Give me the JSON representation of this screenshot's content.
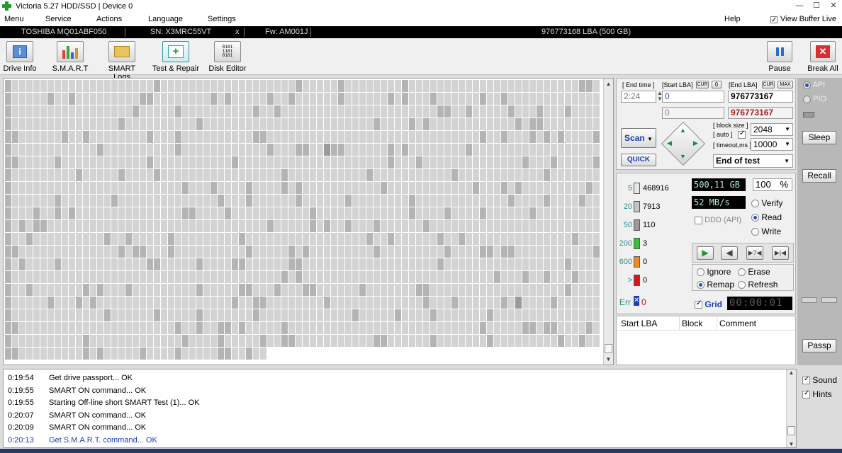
{
  "title": "Victoria 5.27 HDD/SSD | Device 0",
  "window_controls": [
    "—",
    "☐",
    "✕"
  ],
  "menu": {
    "items": [
      "Menu",
      "Service",
      "Actions",
      "Language",
      "Settings"
    ],
    "help": "Help",
    "view_buffer_live": "View Buffer Live"
  },
  "drive_info_bar": {
    "model": "TOSHIBA MQ01ABF050",
    "serial": "SN: X3MRC55VT",
    "close": "x",
    "firmware": "Fw: AM001J",
    "capacity": "976773168 LBA (500 GB)"
  },
  "toolbar": {
    "drive_info": "Drive Info",
    "smart": "S.M.A.R.T",
    "smart_logs": "SMART Logs",
    "test_repair": "Test & Repair",
    "disk_editor": "Disk Editor",
    "pause": "Pause",
    "break_all": "Break All"
  },
  "scan_settings": {
    "end_time_label": "[ End time ]",
    "end_time": "2:24",
    "start_lba_label": "[Start LBA]",
    "cur_label": "CUR",
    "zero_label": "0",
    "end_lba_label": "[End LBA]",
    "max_label": "MAX",
    "start_lba": "0",
    "end_lba": "976773167",
    "start_lba_2": "0",
    "end_lba_2": "976773167",
    "scan_button": "Scan",
    "quick_button": "QUICK",
    "block_size_label": "[ block size ]",
    "auto_label": "[ auto ]",
    "block_size": "2048",
    "timeout_label": "[ timeout,ms ]",
    "timeout": "10000",
    "end_action": "End of test"
  },
  "stats": {
    "rows": [
      {
        "label": "5",
        "value": "468916",
        "color": "#e8e8e8"
      },
      {
        "label": "20",
        "value": "7913",
        "color": "#c4c4c4"
      },
      {
        "label": "50",
        "value": "110",
        "color": "#9a9a9a"
      },
      {
        "label": "200",
        "value": "3",
        "color": "#36c236"
      },
      {
        "label": "600",
        "value": "0",
        "color": "#f08c1e"
      },
      {
        "label": ">",
        "value": "0",
        "color": "#d81818"
      }
    ],
    "err_label": "Err",
    "err_value": "0",
    "size_done": "500,11 GB",
    "percent": "100",
    "percent_sign": "%",
    "speed": "52 MB/s",
    "ddd_label": "DDD (API)",
    "mode_verify": "Verify",
    "mode_read": "Read",
    "mode_write": "Write",
    "action_ignore": "Ignore",
    "action_erase": "Erase",
    "action_remap": "Remap",
    "action_refresh": "Refresh",
    "grid_label": "Grid",
    "elapsed": "00:00:01"
  },
  "defects_table": {
    "columns": [
      "Start LBA",
      "Block",
      "Comment"
    ]
  },
  "side": {
    "api": "API",
    "pio": "PIO",
    "sleep": "Sleep",
    "recall": "Recall",
    "passp": "Passp",
    "sound": "Sound",
    "hints": "Hints"
  },
  "log": [
    {
      "time": "0:19:54",
      "text": "Get drive passport... OK",
      "color": "#000000"
    },
    {
      "time": "0:19:55",
      "text": "SMART ON command... OK",
      "color": "#000000"
    },
    {
      "time": "0:19:55",
      "text": "Starting Off-line short SMART Test (1)... OK",
      "color": "#000000"
    },
    {
      "time": "0:20:07",
      "text": "SMART ON command... OK",
      "color": "#000000"
    },
    {
      "time": "0:20:09",
      "text": "SMART ON command... OK",
      "color": "#000000"
    },
    {
      "time": "0:20:13",
      "text": "Get S.M.A.R.T. command... OK",
      "color": "#1a3fb0"
    }
  ]
}
